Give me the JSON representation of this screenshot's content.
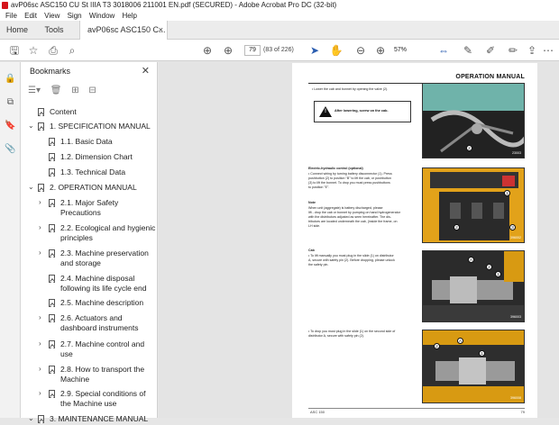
{
  "window": {
    "title": "avP06sc ASC150 CU St IIIA T3 3018006 211001 EN.pdf (SECURED) - Adobe Acrobat Pro DC (32-bit)"
  },
  "menu": [
    "File",
    "Edit",
    "View",
    "Sign",
    "Window",
    "Help"
  ],
  "tabs": {
    "home": "Home",
    "tools": "Tools",
    "doc": "avP06sc ASC150 C...",
    "close": "×"
  },
  "toolbar": {
    "page_value": "79",
    "page_count": "(83 of 226)",
    "zoom": "57%"
  },
  "bookmarks": {
    "title": "Bookmarks",
    "close": "✕",
    "items": [
      {
        "label": "Content",
        "level": 0,
        "arrow": ""
      },
      {
        "label": "1. SPECIFICATION MANUAL",
        "level": 0,
        "arrow": "⌄"
      },
      {
        "label": "1.1. Basic Data",
        "level": 1,
        "arrow": ""
      },
      {
        "label": "1.2. Dimension Chart",
        "level": 1,
        "arrow": ""
      },
      {
        "label": "1.3. Technical Data",
        "level": 1,
        "arrow": ""
      },
      {
        "label": "2. OPERATION MANUAL",
        "level": 0,
        "arrow": "⌄"
      },
      {
        "label": "2.1. Major Safety",
        "label2": "Precautions",
        "level": 1,
        "arrow": "›"
      },
      {
        "label": "2.2. Ecological and hygienic",
        "label2": "principles",
        "level": 1,
        "arrow": "›"
      },
      {
        "label": "2.3. Machine preservation",
        "label2": "and storage",
        "level": 1,
        "arrow": "›"
      },
      {
        "label": "2.4. Machine disposal",
        "label2": "following its life cycle end",
        "level": 1,
        "arrow": ""
      },
      {
        "label": "2.5. Machine description",
        "level": 1,
        "arrow": ""
      },
      {
        "label": "2.6. Actuators and",
        "label2": "dashboard instruments",
        "level": 1,
        "arrow": "›"
      },
      {
        "label": "2.7. Machine control and",
        "label2": "use",
        "level": 1,
        "arrow": "›"
      },
      {
        "label": "2.8. How to transport the",
        "label2": "Machine",
        "level": 1,
        "arrow": "›"
      },
      {
        "label": "2.9. Special conditions of",
        "label2": "the Machine use",
        "level": 1,
        "arrow": "›"
      },
      {
        "label": "3. MAINTENANCE MANUAL",
        "level": 0,
        "arrow": "⌄"
      }
    ]
  },
  "page": {
    "header": "OPERATION MANUAL",
    "line1": "•   Lower the cab and bonnet by opening the valve (2).",
    "warning": "After lowering, screw on the cab.",
    "ehc_title": "Electric-hydraulic control (optional)",
    "ehc_text1": "•   Connect wiring by turning battery disconnector (1). Press",
    "ehc_text2": "    pushbutton (2) to position \"B\" to lift the cab, or pushbutton",
    "ehc_text3": "    (3) to lift the bonnet. To drop you must press pushbuttons",
    "ehc_text4": "    to position \"E\".",
    "note_title": "Note",
    "note1": "When unit (aggregate) is battery discharged, please",
    "note2": "lift - drop the cab or bonnet by pumping on hand hydrogenerator",
    "note3": "with the distributors adjusted as seen hereinafter. The dis-",
    "note4": "tributors are located underneath the cab, (inside the frame, on",
    "note5": "LH side.",
    "cab_title": "Cab",
    "cab1": "•   To lift manually you must plug in the slide (1) on distributor",
    "cab2": "    A, secure with safety pin (2). Before dropping, please unlock",
    "cab3": "    the safety pin.",
    "drop1": "•   To drop you must plug in the slide (1) on the second side of",
    "drop2": "    distributor A, secure with safety pin (2).",
    "photo_codes": [
      "23003",
      "396002",
      "396003",
      "396008"
    ],
    "footer_left": "ASC 150",
    "footer_right": "79"
  }
}
